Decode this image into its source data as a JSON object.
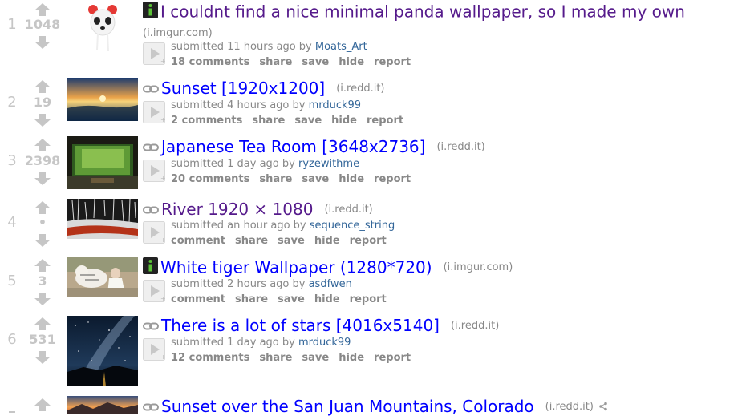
{
  "colors": {
    "link": "#0000ff",
    "visited": "#551a8b",
    "muted": "#888888",
    "author": "#336699",
    "arrow": "#c6c6c6"
  },
  "posts": [
    {
      "rank": "1",
      "score": "1048",
      "type_icon": "image-post-icon",
      "title": "I couldnt find a nice minimal panda wallpaper, so I made my own",
      "domain": "(i.imgur.com)",
      "submitted": "submitted 11 hours ago by",
      "author": "Moats_Art",
      "comments": "18 comments",
      "share": "share",
      "save": "save",
      "hide": "hide",
      "report": "report"
    },
    {
      "rank": "2",
      "score": "19",
      "type_icon": "link-icon",
      "title": "Sunset [1920x1200]",
      "domain": "(i.redd.it)",
      "submitted": "submitted 4 hours ago by",
      "author": "mrduck99",
      "comments": "2 comments",
      "share": "share",
      "save": "save",
      "hide": "hide",
      "report": "report"
    },
    {
      "rank": "3",
      "score": "2398",
      "type_icon": "link-icon",
      "title": "Japanese Tea Room [3648x2736]",
      "domain": "(i.redd.it)",
      "submitted": "submitted 1 day ago by",
      "author": "ryzewithme",
      "comments": "20 comments",
      "share": "share",
      "save": "save",
      "hide": "hide",
      "report": "report"
    },
    {
      "rank": "4",
      "score": "•",
      "type_icon": "link-icon",
      "title": "River 1920 × 1080",
      "domain": "(i.redd.it)",
      "submitted": "submitted an hour ago by",
      "author": "sequence_string",
      "comments": "comment",
      "share": "share",
      "save": "save",
      "hide": "hide",
      "report": "report"
    },
    {
      "rank": "5",
      "score": "3",
      "type_icon": "image-post-icon",
      "title": "White tiger Wallpaper (1280*720)",
      "domain": "(i.imgur.com)",
      "submitted": "submitted 2 hours ago by",
      "author": "asdfwen",
      "comments": "comment",
      "share": "share",
      "save": "save",
      "hide": "hide",
      "report": "report"
    },
    {
      "rank": "6",
      "score": "531",
      "type_icon": "link-icon",
      "title": "There is a lot of stars [4016x5140]",
      "domain": "(i.redd.it)",
      "submitted": "submitted 1 day ago by",
      "author": "mrduck99",
      "comments": "12 comments",
      "share": "share",
      "save": "save",
      "hide": "hide",
      "report": "report"
    },
    {
      "rank": "",
      "score": "",
      "type_icon": "link-icon",
      "title": "Sunset over the San Juan Mountains, Colorado",
      "domain": "(i.redd.it)"
    }
  ]
}
